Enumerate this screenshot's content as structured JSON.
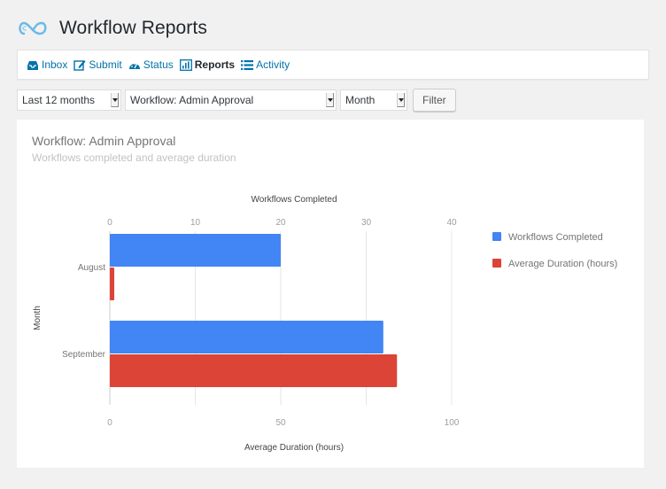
{
  "header": {
    "title": "Workflow Reports",
    "logo_icon": "infinity-cloud-logo"
  },
  "nav": {
    "items": [
      {
        "label": "Inbox",
        "icon": "inbox-icon",
        "active": false
      },
      {
        "label": "Submit",
        "icon": "edit-icon",
        "active": false
      },
      {
        "label": "Status",
        "icon": "dashboard-icon",
        "active": false
      },
      {
        "label": "Reports",
        "icon": "bar-chart-icon",
        "active": true
      },
      {
        "label": "Activity",
        "icon": "list-icon",
        "active": false
      }
    ]
  },
  "filters": {
    "period": "Last 12 months",
    "workflow": "Workflow: Admin Approval",
    "group_by": "Month",
    "filter_button": "Filter"
  },
  "panel": {
    "title": "Workflow: Admin Approval",
    "subtitle": "Workflows completed and average duration"
  },
  "chart_data": {
    "type": "bar",
    "orientation": "horizontal",
    "categories": [
      "August",
      "September"
    ],
    "series": [
      {
        "name": "Workflows Completed",
        "color": "#4285f4",
        "axis": "top",
        "values": [
          20,
          32
        ]
      },
      {
        "name": "Average Duration (hours)",
        "color": "#db4437",
        "axis": "bottom",
        "values": [
          1.3,
          84
        ]
      }
    ],
    "top_axis": {
      "label": "Workflows Completed",
      "range": [
        0,
        40
      ],
      "ticks": [
        0,
        10,
        20,
        30,
        40
      ]
    },
    "bottom_axis": {
      "label": "Average Duration (hours)",
      "range": [
        0,
        100
      ],
      "ticks": [
        0,
        50,
        100
      ]
    },
    "ylabel": "Month",
    "legend": "right",
    "grid": true
  }
}
